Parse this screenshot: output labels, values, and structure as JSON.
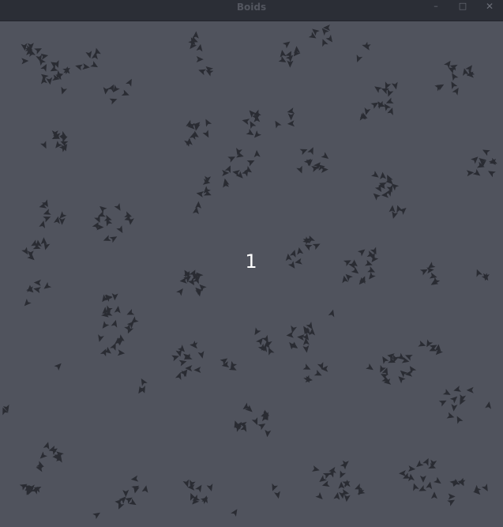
{
  "window": {
    "title": "Boids",
    "controls": {
      "minimize": "–",
      "maximize": "□",
      "close": "✕"
    }
  },
  "scene": {
    "counter": "1",
    "colors": {
      "background": "#50535d",
      "boid": "#2a2c33",
      "counter_text": "#ffffff",
      "titlebar": "#2b2e36"
    },
    "boid_shape": "triangle-icon"
  }
}
